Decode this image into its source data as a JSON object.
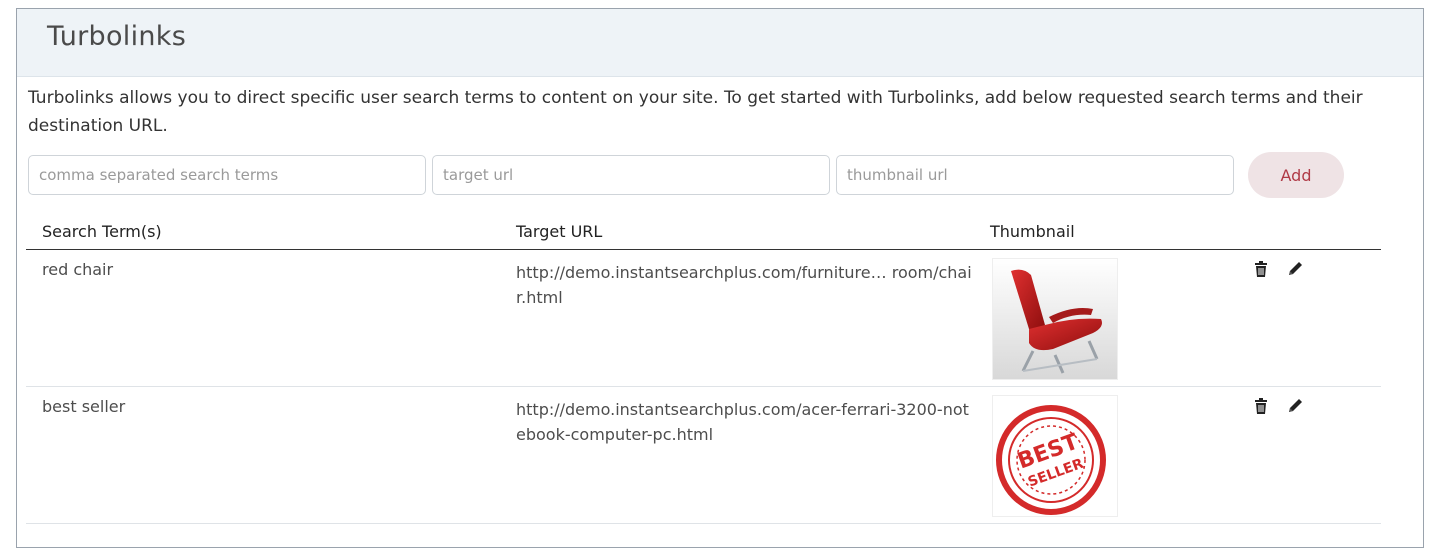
{
  "page": {
    "title": "Turbolinks",
    "description": "Turbolinks allows you to direct specific user search terms to content on your site. To get started with Turbolinks, add below requested search terms and their destination URL."
  },
  "form": {
    "terms_placeholder": "comma separated search terms",
    "target_placeholder": "target url",
    "thumbnail_placeholder": "thumbnail url",
    "add_label": "Add"
  },
  "table": {
    "headers": {
      "terms": "Search Term(s)",
      "target": "Target URL",
      "thumbnail": "Thumbnail"
    },
    "rows": [
      {
        "terms": "red chair",
        "target": "http://demo.instantsearchplus.com/furniture… room/chair.html",
        "thumbnail_icon": "red-chair-image"
      },
      {
        "terms": "best seller",
        "target": "http://demo.instantsearchplus.com/acer-ferrari-3200-notebook-computer-pc.html",
        "thumbnail_icon": "best-seller-stamp-image"
      }
    ]
  },
  "icons": {
    "delete": "trash-icon",
    "edit": "pencil-icon"
  },
  "colors": {
    "header_bg": "#eef3f7",
    "add_button_bg": "#efe3e5",
    "add_button_text": "#b03a46",
    "stamp_red": "#d42a2a"
  }
}
